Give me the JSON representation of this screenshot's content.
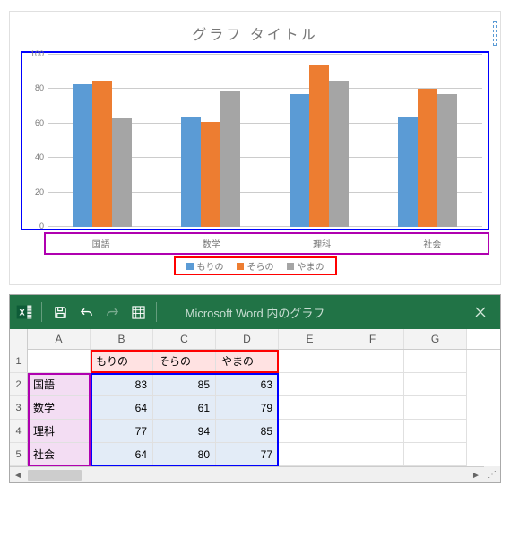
{
  "chart_data": {
    "type": "bar",
    "title": "グラフ タイトル",
    "categories": [
      "国語",
      "数学",
      "理科",
      "社会"
    ],
    "series": [
      {
        "name": "もりの",
        "values": [
          83,
          64,
          77,
          64
        ],
        "color": "#5b9bd5"
      },
      {
        "name": "そらの",
        "values": [
          85,
          61,
          94,
          80
        ],
        "color": "#ed7d31"
      },
      {
        "name": "やまの",
        "values": [
          63,
          79,
          85,
          77
        ],
        "color": "#a5a5a5"
      }
    ],
    "xlabel": "",
    "ylabel": "",
    "ylim": [
      0,
      100
    ],
    "yticks": [
      0,
      20,
      40,
      60,
      80,
      100
    ],
    "legend_position": "bottom",
    "grid": true
  },
  "excel": {
    "window_title": "Microsoft Word 内のグラフ",
    "columns": [
      "A",
      "B",
      "C",
      "D",
      "E",
      "F",
      "G"
    ],
    "row_numbers": [
      1,
      2,
      3,
      4,
      5
    ],
    "headers": [
      "もりの",
      "そらの",
      "やまの"
    ],
    "categories": [
      "国語",
      "数学",
      "理科",
      "社会"
    ],
    "values": [
      [
        83,
        85,
        63
      ],
      [
        64,
        61,
        79
      ],
      [
        77,
        94,
        85
      ],
      [
        64,
        80,
        77
      ]
    ]
  }
}
